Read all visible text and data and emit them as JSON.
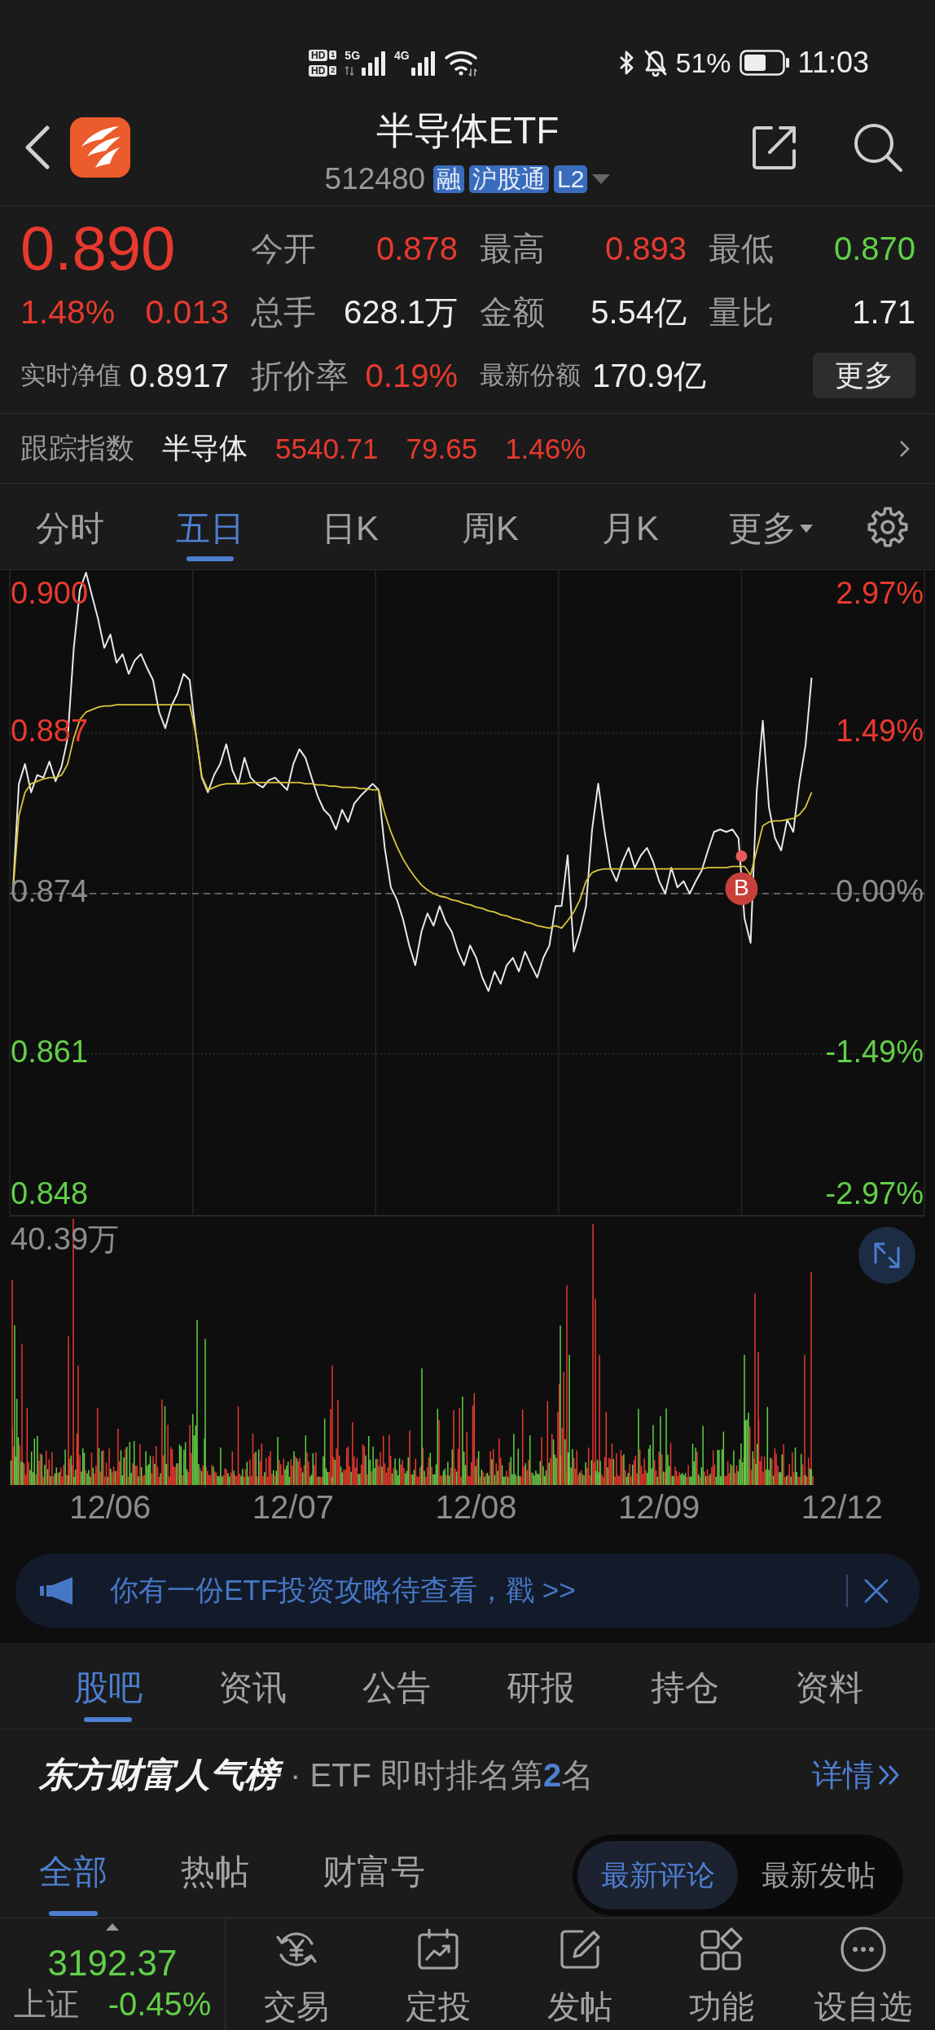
{
  "status_bar": {
    "sims": [
      {
        "badge": "HD",
        "slot": "1"
      },
      {
        "badge": "HD",
        "slot": "2"
      }
    ],
    "networks": [
      {
        "label": "5G",
        "data_activity": true
      },
      {
        "label": "4G",
        "data_activity": false
      }
    ],
    "battery": "51%",
    "time": "11:03"
  },
  "header": {
    "title": "半导体ETF",
    "code": "512480",
    "tags": [
      "融",
      "沪股通",
      "L2"
    ]
  },
  "quote": {
    "price": "0.890",
    "change_percent": "1.48%",
    "change": "0.013",
    "stats": [
      {
        "label": "今开",
        "value": "0.878",
        "color": "#e8392e"
      },
      {
        "label": "最高",
        "value": "0.893",
        "color": "#e8392e"
      },
      {
        "label": "最低",
        "value": "0.870",
        "color": "#62cf48"
      },
      {
        "label": "总手",
        "value": "628.1万",
        "color": "#eeeeee"
      },
      {
        "label": "金额",
        "value": "5.54亿",
        "color": "#eeeeee"
      },
      {
        "label": "量比",
        "value": "1.71",
        "color": "#eeeeee"
      }
    ],
    "nav": {
      "label": "实时净值",
      "value": "0.8917",
      "color": "#eeeeee"
    },
    "discount": {
      "label": "折价率",
      "value": "0.19%",
      "color": "#e8392e"
    },
    "shares": {
      "label": "最新份额",
      "value": "170.9亿",
      "color": "#eeeeee"
    },
    "more_button": "更多"
  },
  "tracking_index": {
    "label": "跟踪指数",
    "name": "半导体",
    "value": "5540.71",
    "change": "79.65",
    "change_percent": "1.46%"
  },
  "period_tabs": [
    {
      "label": "分时",
      "selected": false,
      "dropdown": false
    },
    {
      "label": "五日",
      "selected": true,
      "dropdown": false
    },
    {
      "label": "日K",
      "selected": false,
      "dropdown": false
    },
    {
      "label": "周K",
      "selected": false,
      "dropdown": false
    },
    {
      "label": "月K",
      "selected": false,
      "dropdown": false
    },
    {
      "label": "更多",
      "selected": false,
      "dropdown": true
    }
  ],
  "chart": {
    "chart_data": {
      "type": "line",
      "ylim": [
        0.848,
        0.9
      ],
      "yticks": [
        {
          "value": 0.9,
          "label": "0.900"
        },
        {
          "value": 0.887,
          "label": "0.887"
        },
        {
          "value": 0.874,
          "label": "0.874"
        },
        {
          "value": 0.861,
          "label": "0.861"
        },
        {
          "value": 0.848,
          "label": "0.848"
        }
      ],
      "grid": true,
      "ref_lines": [
        {
          "axis": "y",
          "value": 0.874
        }
      ],
      "series": [
        {
          "color": "#e8e8e8",
          "values": [
            0.874,
            0.8829,
            0.8845,
            0.8822,
            0.8836,
            0.8834,
            0.8847,
            0.8831,
            0.8843,
            0.8866,
            0.8939,
            0.8986,
            0.9,
            0.8981,
            0.8962,
            0.8939,
            0.895,
            0.8927,
            0.8934,
            0.8918,
            0.8929,
            0.8934,
            0.8923,
            0.8913,
            0.8887,
            0.8874,
            0.8892,
            0.8902,
            0.8918,
            0.8913,
            0.887,
            0.8834,
            0.8822,
            0.8836,
            0.8845,
            0.8861,
            0.884,
            0.8829,
            0.885,
            0.8834,
            0.8829,
            0.8826,
            0.8832,
            0.8834,
            0.8829,
            0.8824,
            0.8845,
            0.8857,
            0.885,
            0.8834,
            0.8819,
            0.8808,
            0.8803,
            0.8792,
            0.8808,
            0.8798,
            0.8813,
            0.8819,
            0.8824,
            0.8829,
            0.8824,
            0.8777,
            0.8745,
            0.8735,
            0.8719,
            0.8698,
            0.8682,
            0.8709,
            0.8724,
            0.8714,
            0.873,
            0.8717,
            0.8709,
            0.8693,
            0.8682,
            0.8698,
            0.8688,
            0.8672,
            0.8661,
            0.8677,
            0.8667,
            0.8682,
            0.8688,
            0.8677,
            0.8693,
            0.8682,
            0.8672,
            0.8688,
            0.8698,
            0.873,
            0.873,
            0.8771,
            0.8693,
            0.8709,
            0.873,
            0.8792,
            0.8829,
            0.8792,
            0.8761,
            0.875,
            0.8766,
            0.8777,
            0.8761,
            0.8771,
            0.8777,
            0.8766,
            0.875,
            0.874,
            0.8761,
            0.8745,
            0.875,
            0.874,
            0.875,
            0.8759,
            0.8775,
            0.879,
            0.8792,
            0.879,
            0.8792,
            0.8785,
            0.872,
            0.87,
            0.8823,
            0.888,
            0.881,
            0.8785,
            0.8775,
            0.88,
            0.879,
            0.883,
            0.886,
            0.8915,
            null,
            null,
            null,
            null,
            null,
            null,
            null,
            null,
            null,
            null,
            null,
            null,
            null,
            null,
            null,
            null,
            null,
            null
          ]
        },
        {
          "color": "#d9c63a",
          "values": [
            0.874,
            0.8803,
            0.8822,
            0.8829,
            0.8831,
            0.8833,
            0.8834,
            0.8834,
            0.8836,
            0.8845,
            0.8866,
            0.8881,
            0.8887,
            0.8889,
            0.8891,
            0.8892,
            0.8892,
            0.8893,
            0.8893,
            0.8893,
            0.8893,
            0.8893,
            0.8893,
            0.8893,
            0.8893,
            0.8893,
            0.8893,
            0.8893,
            0.8893,
            0.8893,
            0.887,
            0.8835,
            0.8824,
            0.8826,
            0.8828,
            0.8829,
            0.8829,
            0.8829,
            0.8829,
            0.883,
            0.883,
            0.883,
            0.883,
            0.883,
            0.883,
            0.883,
            0.883,
            0.883,
            0.8829,
            0.8829,
            0.8828,
            0.8828,
            0.8827,
            0.8827,
            0.8826,
            0.8826,
            0.8826,
            0.8825,
            0.8825,
            0.8824,
            0.8824,
            0.8805,
            0.879,
            0.8778,
            0.8768,
            0.876,
            0.8753,
            0.8747,
            0.8743,
            0.874,
            0.8738,
            0.8737,
            0.8735,
            0.8734,
            0.8732,
            0.8731,
            0.8729,
            0.8728,
            0.8726,
            0.8725,
            0.8723,
            0.8722,
            0.872,
            0.8719,
            0.8717,
            0.8716,
            0.8714,
            0.8713,
            0.8712,
            0.8714,
            0.8712,
            0.8718,
            0.8725,
            0.8735,
            0.875,
            0.8757,
            0.8759,
            0.876,
            0.876,
            0.876,
            0.876,
            0.876,
            0.876,
            0.876,
            0.876,
            0.876,
            0.876,
            0.876,
            0.876,
            0.876,
            0.876,
            0.876,
            0.876,
            0.876,
            0.8761,
            0.8761,
            0.8761,
            0.8761,
            0.8762,
            0.8762,
            0.8762,
            0.8755,
            0.8775,
            0.8795,
            0.8798,
            0.8799,
            0.8799,
            0.88,
            0.8801,
            0.8804,
            0.881,
            0.8822,
            null,
            null,
            null,
            null,
            null,
            null,
            null,
            null,
            null,
            null,
            null,
            null,
            null,
            null,
            null,
            null,
            null,
            null
          ]
        }
      ],
      "annotations": [
        {
          "text": "B",
          "y": 0.8744
        }
      ]
    },
    "percent_ticks": [
      "2.97%",
      "1.49%",
      "0.00%",
      "-1.49%",
      "-2.97%"
    ],
    "volume_max": "40.39万",
    "dates": [
      "12/06",
      "12/07",
      "12/08",
      "12/09",
      "12/12"
    ]
  },
  "banner": {
    "text": "你有一份ETF投资攻略待查看，戳 >>"
  },
  "content_tabs": [
    {
      "label": "股吧",
      "selected": true
    },
    {
      "label": "资讯",
      "selected": false
    },
    {
      "label": "公告",
      "selected": false
    },
    {
      "label": "研报",
      "selected": false
    },
    {
      "label": "持仓",
      "selected": false
    },
    {
      "label": "资料",
      "selected": false
    }
  ],
  "ranking": {
    "title": "东方财富人气榜",
    "text": "· ETF 即时排名第**2**名",
    "link": "详情"
  },
  "feed_tabs": [
    {
      "label": "全部",
      "selected": true
    },
    {
      "label": "热帖",
      "selected": false
    },
    {
      "label": "财富号",
      "selected": false
    }
  ],
  "sort_options": [
    {
      "label": "最新评论",
      "selected": true
    },
    {
      "label": "最新发帖",
      "selected": false
    }
  ],
  "bottom_bar": {
    "index": {
      "value": "3192.37",
      "name": "上证",
      "change": "-0.45%"
    },
    "items": [
      {
        "label": "交易",
        "kind": "trade"
      },
      {
        "label": "定投",
        "kind": "plan"
      },
      {
        "label": "发帖",
        "kind": "post"
      },
      {
        "label": "功能",
        "kind": "apps"
      },
      {
        "label": "设自选",
        "kind": "watch"
      }
    ]
  }
}
